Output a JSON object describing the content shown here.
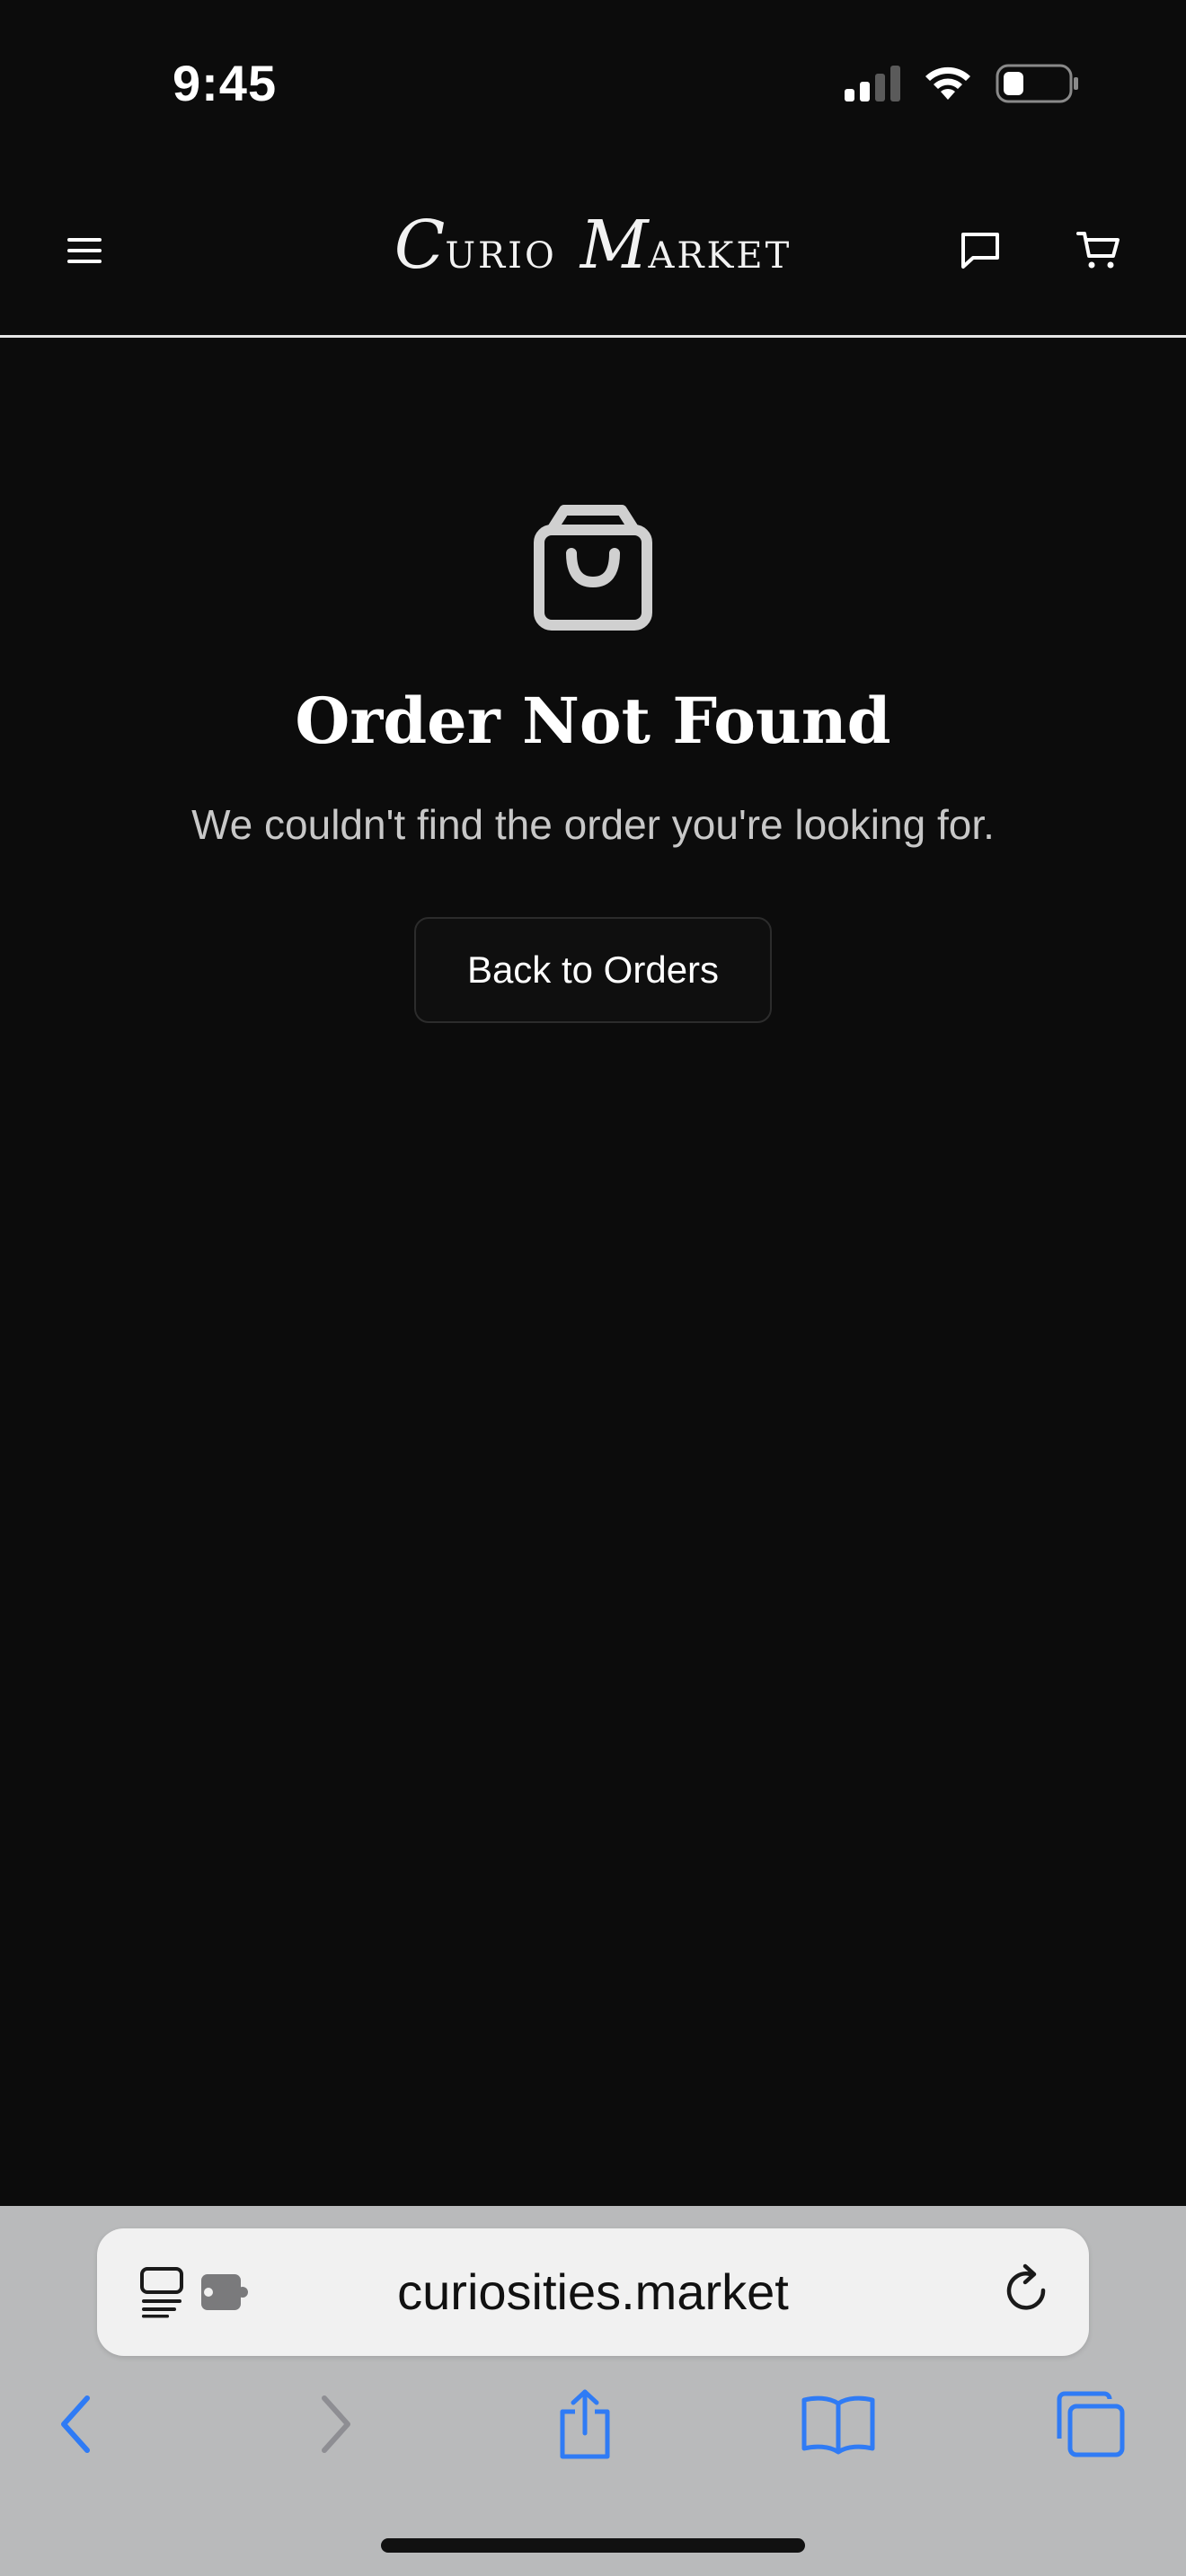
{
  "status_bar": {
    "time": "9:45",
    "icons": [
      "cellular-signal-icon",
      "wifi-icon",
      "battery-icon"
    ]
  },
  "header": {
    "logo": {
      "word1_initial": "C",
      "word1_rest": "URIO",
      "word2_initial": "M",
      "word2_rest": "ARKET"
    },
    "icons": [
      "menu-icon",
      "chat-icon",
      "cart-icon"
    ]
  },
  "main": {
    "icon": "shopping-bag-icon",
    "title": "Order Not Found",
    "message": "We couldn't find the order you're looking for.",
    "back_button_label": "Back to Orders"
  },
  "browser": {
    "url": "curiosities.market",
    "toolbar_icons": [
      "back-icon",
      "forward-icon",
      "share-icon",
      "bookmarks-icon",
      "tabs-icon"
    ],
    "accent_color": "#2f7bf5",
    "disabled_color": "#8e8e93"
  },
  "colors": {
    "page_background": "#0c0c0c",
    "header_divider": "#e6e6e6",
    "message_text": "#c8c8c8",
    "browser_bar": "#b9babb"
  }
}
